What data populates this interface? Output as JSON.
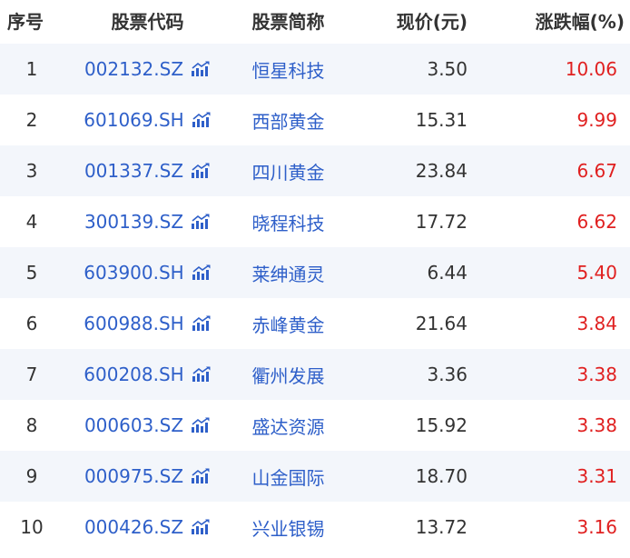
{
  "header": {
    "index": "序号",
    "code": "股票代码",
    "name": "股票简称",
    "price": "现价(元)",
    "change": "涨跌幅(%)"
  },
  "rows": [
    {
      "index": "1",
      "code": "002132.SZ",
      "name": "恒星科技",
      "price": "3.50",
      "change": "10.06"
    },
    {
      "index": "2",
      "code": "601069.SH",
      "name": "西部黄金",
      "price": "15.31",
      "change": "9.99"
    },
    {
      "index": "3",
      "code": "001337.SZ",
      "name": "四川黄金",
      "price": "23.84",
      "change": "6.67"
    },
    {
      "index": "4",
      "code": "300139.SZ",
      "name": "晓程科技",
      "price": "17.72",
      "change": "6.62"
    },
    {
      "index": "5",
      "code": "603900.SH",
      "name": "莱绅通灵",
      "price": "6.44",
      "change": "5.40"
    },
    {
      "index": "6",
      "code": "600988.SH",
      "name": "赤峰黄金",
      "price": "21.64",
      "change": "3.84"
    },
    {
      "index": "7",
      "code": "600208.SH",
      "name": "衢州发展",
      "price": "3.36",
      "change": "3.38"
    },
    {
      "index": "8",
      "code": "000603.SZ",
      "name": "盛达资源",
      "price": "15.92",
      "change": "3.38"
    },
    {
      "index": "9",
      "code": "000975.SZ",
      "name": "山金国际",
      "price": "18.70",
      "change": "3.31"
    },
    {
      "index": "10",
      "code": "000426.SZ",
      "name": "兴业银锡",
      "price": "13.72",
      "change": "3.16"
    }
  ],
  "icons": {
    "row_chart": "stock-chart-icon"
  },
  "colors": {
    "link_blue": "#2e5fc9",
    "rise_red": "#e02020",
    "stripe": "#f3f6fb",
    "text": "#333333"
  }
}
